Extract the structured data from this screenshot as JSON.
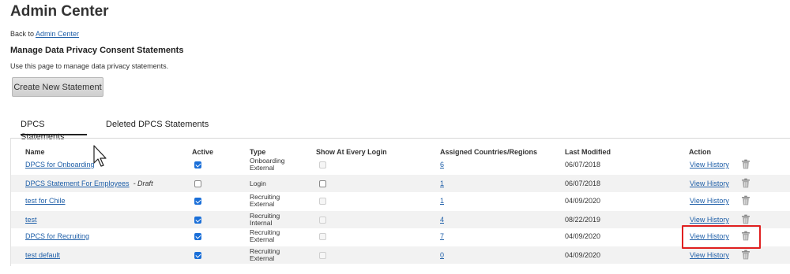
{
  "page": {
    "title": "Admin Center",
    "back_prefix": "Back to",
    "back_link": "Admin Center",
    "subtitle": "Manage Data Privacy Consent Statements",
    "description": "Use this page to manage data privacy statements.",
    "create_button": "Create New Statement"
  },
  "tabs": [
    {
      "label": "DPCS Statements",
      "active": true
    },
    {
      "label": "Deleted DPCS Statements",
      "active": false
    }
  ],
  "table": {
    "headers": {
      "name": "Name",
      "active": "Active",
      "type": "Type",
      "show": "Show At Every Login",
      "countries": "Assigned Countries/Regions",
      "modified": "Last Modified",
      "action": "Action"
    },
    "action_label": "View History",
    "draft_label": "- Draft",
    "rows": [
      {
        "name": "DPCS for Onboarding",
        "draft": false,
        "active": true,
        "type1": "Onboarding",
        "type2": "External",
        "show": false,
        "show_enabled": false,
        "countries": "6",
        "modified": "06/07/2018"
      },
      {
        "name": "DPCS Statement For Employees",
        "draft": true,
        "active": false,
        "type1": "Login",
        "type2": "",
        "show": false,
        "show_enabled": true,
        "countries": "1",
        "modified": "06/07/2018"
      },
      {
        "name": "test for Chile",
        "draft": false,
        "active": true,
        "type1": "Recruiting",
        "type2": "External",
        "show": false,
        "show_enabled": false,
        "countries": "1",
        "modified": "04/09/2020"
      },
      {
        "name": "test",
        "draft": false,
        "active": true,
        "type1": "Recruiting",
        "type2": "Internal",
        "show": false,
        "show_enabled": false,
        "countries": "4",
        "modified": "08/22/2019"
      },
      {
        "name": "DPCS for Recruiting",
        "draft": false,
        "active": true,
        "type1": "Recruiting",
        "type2": "External",
        "show": false,
        "show_enabled": false,
        "countries": "7",
        "modified": "04/09/2020",
        "highlighted": true
      },
      {
        "name": "test default",
        "draft": false,
        "active": true,
        "type1": "Recruiting",
        "type2": "External",
        "show": false,
        "show_enabled": false,
        "countries": "0",
        "modified": "04/09/2020"
      }
    ]
  },
  "colors": {
    "link": "#1f5fa8",
    "checkbox_on": "#1a6fd8",
    "highlight": "#e02020",
    "row_alt": "#f2f2f2"
  },
  "icons": {
    "trash": "trash-icon",
    "cursor": "mouse-pointer-icon"
  }
}
